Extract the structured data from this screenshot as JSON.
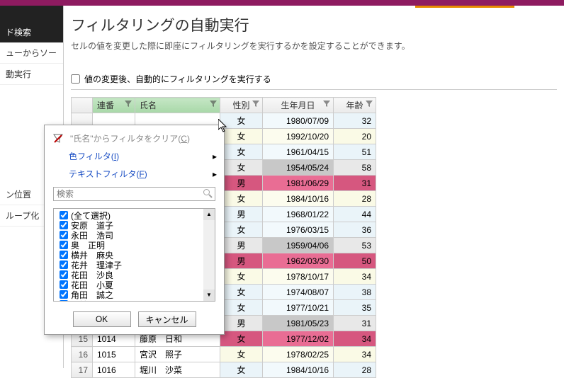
{
  "side": {
    "search_label": "ド検索",
    "items": [
      "ューからソー",
      "動実行",
      "ン位置",
      "ループ化"
    ]
  },
  "page": {
    "title": "フィルタリングの自動実行",
    "desc": "セルの値を変更した際に即座にフィルタリングを実行するかを設定することができます。",
    "auto_label": "値の変更後、自動的にフィルタリングを実行する"
  },
  "columns": {
    "seq": "連番",
    "name": "氏名",
    "sex": "性別",
    "date": "生年月日",
    "age": "年齢"
  },
  "rows": [
    {
      "n": "",
      "seq": "",
      "name": "",
      "sex": "女",
      "date": "1980/07/09",
      "age": "32",
      "cls": "b"
    },
    {
      "n": "",
      "seq": "",
      "name": "",
      "sex": "女",
      "date": "1992/10/20",
      "age": "20",
      "cls": "y"
    },
    {
      "n": "",
      "seq": "",
      "name": "",
      "sex": "女",
      "date": "1961/04/15",
      "age": "51",
      "cls": "b"
    },
    {
      "n": "",
      "seq": "",
      "name": "",
      "sex": "女",
      "date": "1954/05/24",
      "age": "58",
      "cls": "g"
    },
    {
      "n": "",
      "seq": "",
      "name": "",
      "sex": "男",
      "date": "1981/06/29",
      "age": "31",
      "cls": "p"
    },
    {
      "n": "",
      "seq": "",
      "name": "",
      "sex": "女",
      "date": "1984/10/16",
      "age": "28",
      "cls": "y"
    },
    {
      "n": "",
      "seq": "",
      "name": "",
      "sex": "男",
      "date": "1968/01/22",
      "age": "44",
      "cls": "b"
    },
    {
      "n": "",
      "seq": "",
      "name": "",
      "sex": "女",
      "date": "1976/03/15",
      "age": "36",
      "cls": "b"
    },
    {
      "n": "",
      "seq": "",
      "name": "",
      "sex": "男",
      "date": "1959/04/06",
      "age": "53",
      "cls": "g"
    },
    {
      "n": "",
      "seq": "",
      "name": "",
      "sex": "男",
      "date": "1962/03/30",
      "age": "50",
      "cls": "p"
    },
    {
      "n": "",
      "seq": "",
      "name": "",
      "sex": "女",
      "date": "1978/10/17",
      "age": "34",
      "cls": "y"
    },
    {
      "n": "",
      "seq": "",
      "name": "",
      "sex": "女",
      "date": "1974/08/07",
      "age": "38",
      "cls": "b"
    },
    {
      "n": "",
      "seq": "",
      "name": "",
      "sex": "女",
      "date": "1977/10/21",
      "age": "35",
      "cls": "b"
    },
    {
      "n": "",
      "seq": "",
      "name": "",
      "sex": "男",
      "date": "1981/05/23",
      "age": "31",
      "cls": "g"
    },
    {
      "n": "15",
      "seq": "1014",
      "name": "藤原　日和",
      "sex": "女",
      "date": "1977/12/02",
      "age": "34",
      "cls": "p"
    },
    {
      "n": "16",
      "seq": "1015",
      "name": "宮沢　照子",
      "sex": "女",
      "date": "1978/02/25",
      "age": "34",
      "cls": "y"
    },
    {
      "n": "17",
      "seq": "1016",
      "name": "堀川　沙菜",
      "sex": "女",
      "date": "1984/10/16",
      "age": "28",
      "cls": "b"
    }
  ],
  "popup": {
    "clear_pre": "\"氏名\"からフィルタをクリア(",
    "clear_u": "C",
    "clear_post": ")",
    "color_pre": "色フィルタ(",
    "color_u": "I",
    "color_post": ")",
    "text_pre": "テキストフィルタ(",
    "text_u": "F",
    "text_post": ")",
    "search_placeholder": "検索",
    "items": [
      "(全て選択)",
      "安原　道子",
      "永田　浩司",
      "奥　正明",
      "横井　麻央",
      "花井　理津子",
      "花田　沙良",
      "花田　小夏",
      "角田　誠之",
      "吉崎　亘"
    ],
    "ok": "OK",
    "cancel": "キャンセル"
  }
}
